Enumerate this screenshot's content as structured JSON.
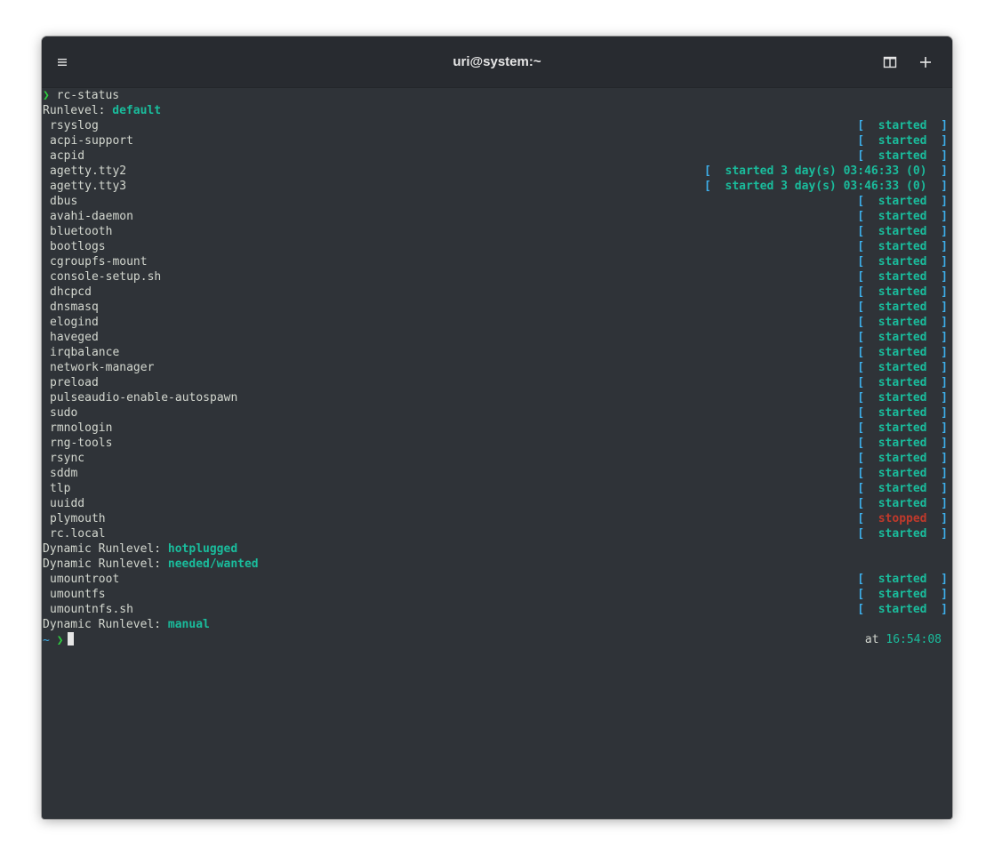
{
  "window": {
    "title": "uri@system:~",
    "icons": {
      "menu": "hamburger-menu-icon",
      "split": "split-view-icon",
      "new_tab": "plus-icon"
    }
  },
  "terminal": {
    "command_prompt_symbol": "❯",
    "command": "rc-status",
    "runlevel_label": "Runlevel: ",
    "runlevel_value": "default",
    "services": [
      {
        "name": "rsyslog",
        "status": "started"
      },
      {
        "name": "acpi-support",
        "status": "started"
      },
      {
        "name": "acpid",
        "status": "started"
      },
      {
        "name": "agetty.tty2",
        "status": "started 3 day(s) 03:46:33 (0)"
      },
      {
        "name": "agetty.tty3",
        "status": "started 3 day(s) 03:46:33 (0)"
      },
      {
        "name": "dbus",
        "status": "started"
      },
      {
        "name": "avahi-daemon",
        "status": "started"
      },
      {
        "name": "bluetooth",
        "status": "started"
      },
      {
        "name": "bootlogs",
        "status": "started"
      },
      {
        "name": "cgroupfs-mount",
        "status": "started"
      },
      {
        "name": "console-setup.sh",
        "status": "started"
      },
      {
        "name": "dhcpcd",
        "status": "started"
      },
      {
        "name": "dnsmasq",
        "status": "started"
      },
      {
        "name": "elogind",
        "status": "started"
      },
      {
        "name": "haveged",
        "status": "started"
      },
      {
        "name": "irqbalance",
        "status": "started"
      },
      {
        "name": "network-manager",
        "status": "started"
      },
      {
        "name": "preload",
        "status": "started"
      },
      {
        "name": "pulseaudio-enable-autospawn",
        "status": "started"
      },
      {
        "name": "sudo",
        "status": "started"
      },
      {
        "name": "rmnologin",
        "status": "started"
      },
      {
        "name": "rng-tools",
        "status": "started"
      },
      {
        "name": "rsync",
        "status": "started"
      },
      {
        "name": "sddm",
        "status": "started"
      },
      {
        "name": "tlp",
        "status": "started"
      },
      {
        "name": "uuidd",
        "status": "started"
      },
      {
        "name": "plymouth",
        "status": "stopped"
      },
      {
        "name": "rc.local",
        "status": "started"
      }
    ],
    "dynamic_label": "Dynamic Runlevel: ",
    "dynamic_hotplugged": "hotplugged",
    "dynamic_needed": "needed/wanted",
    "needed_services": [
      {
        "name": "umountroot",
        "status": "started"
      },
      {
        "name": "umountfs",
        "status": "started"
      },
      {
        "name": "umountnfs.sh",
        "status": "started"
      }
    ],
    "dynamic_manual": "manual",
    "prompt_tilde": "~",
    "prompt_arrow": "❯",
    "rprompt_label": "at ",
    "rprompt_time": "16:54:08"
  },
  "colors": {
    "background": "#2f3338",
    "titlebar": "#282b30",
    "status_ok": "#1abc9c",
    "status_stopped": "#c0392b",
    "bracket": "#3daee9"
  }
}
